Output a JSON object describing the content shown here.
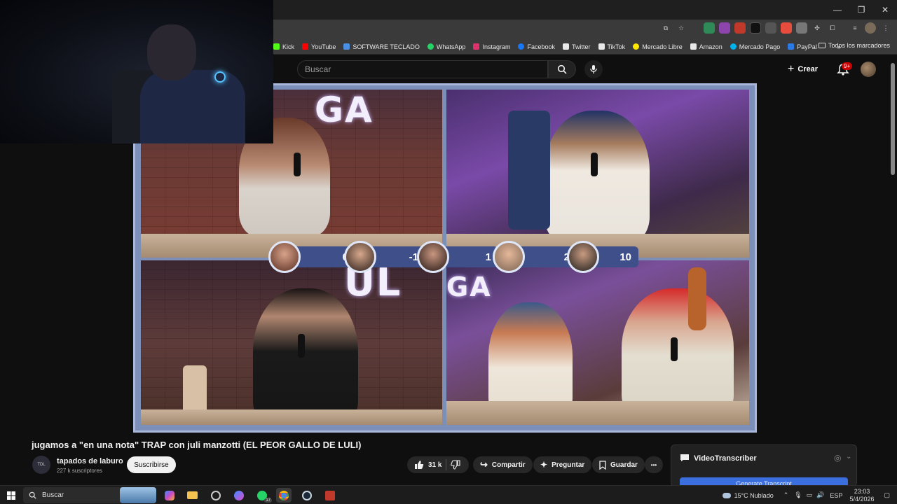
{
  "browser": {
    "window_controls": [
      "—",
      "❐",
      "✕"
    ],
    "bookmarks": [
      {
        "label": "Kick",
        "color": "#53fc18"
      },
      {
        "label": "YouTube",
        "color": "#ff0000"
      },
      {
        "label": "SOFTWARE TECLADO",
        "color": "#4a90e2"
      },
      {
        "label": "WhatsApp",
        "color": "#25d366"
      },
      {
        "label": "Instagram",
        "color": "#e1306c"
      },
      {
        "label": "Facebook",
        "color": "#1877f2"
      },
      {
        "label": "Twitter",
        "color": "#e8e8e8"
      },
      {
        "label": "TikTok",
        "color": "#e8e8e8"
      },
      {
        "label": "Mercado Libre",
        "color": "#ffe600"
      },
      {
        "label": "Amazon",
        "color": "#e8e8e8"
      },
      {
        "label": "Mercado Pago",
        "color": "#00b1ea"
      },
      {
        "label": "PayPal",
        "color": "#2c7be5"
      }
    ],
    "bookmarks_overflow": "»",
    "all_bookmarks": "Todos los marcadores"
  },
  "youtube": {
    "search_placeholder": "Buscar",
    "create_label": "Crear",
    "notifications_badge": "9+"
  },
  "video": {
    "scores": [
      "0",
      "-1",
      "1",
      "2",
      "10"
    ],
    "logo_top": "GA",
    "logo_mid": "UL",
    "logo_right": "GA",
    "title": "jugamos a \"en una nota\" TRAP con juli manzotti (EL PEOR GALLO DE LULI)"
  },
  "channel": {
    "avatar_text": "TDL",
    "name": "tapados de laburo",
    "subscribers": "227 k suscriptores",
    "subscribe_label": "Suscribirse"
  },
  "actions": {
    "likes": "31 k",
    "share": "Compartir",
    "ask": "Preguntar",
    "save": "Guardar",
    "more": "•••"
  },
  "extension": {
    "title": "VideoTranscriber",
    "button": "Generate Transcript"
  },
  "taskbar": {
    "search_placeholder": "Buscar",
    "weather": "15°C  Nublado",
    "language": "ESP",
    "time": "23:03",
    "date": "5/4/2026",
    "whatsapp_badge": "17"
  }
}
